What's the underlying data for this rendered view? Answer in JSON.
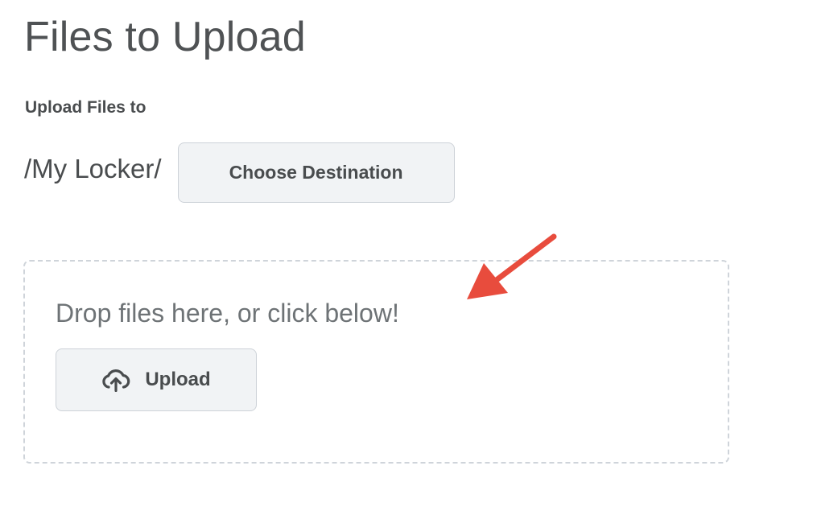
{
  "page": {
    "title": "Files to Upload"
  },
  "destination": {
    "label": "Upload Files to",
    "path": "/My Locker/",
    "choose_button_label": "Choose Destination"
  },
  "dropzone": {
    "prompt": "Drop files here, or click below!",
    "upload_button_label": "Upload",
    "upload_icon": "cloud-upload-icon"
  },
  "annotation": {
    "arrow_icon": "arrow-annotation-icon",
    "arrow_color": "#e84c3d"
  },
  "colors": {
    "text": "#494c4e",
    "button_bg": "#f1f3f5",
    "button_border": "#cdd2d8",
    "dropzone_border": "#cfd4da"
  }
}
